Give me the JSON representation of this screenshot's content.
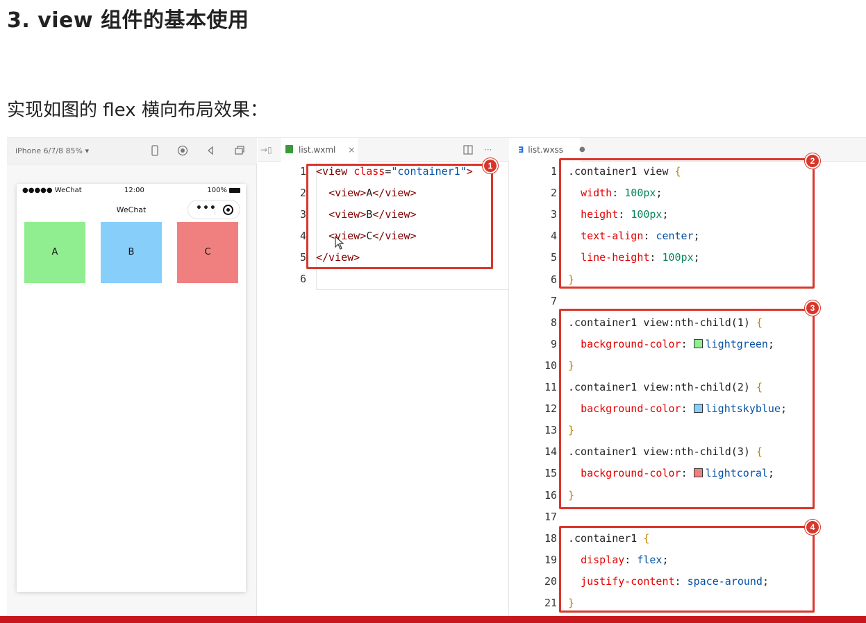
{
  "page": {
    "heading": "3. view 组件的基本使用",
    "subheading": "实现如图的 flex 横向布局效果："
  },
  "simulator": {
    "device_label": "iPhone 6/7/8 85% ▾",
    "toolbar_icons": [
      "phone-icon",
      "record-icon",
      "speaker-icon",
      "window-icon"
    ],
    "status_left": "●●●●● WeChat",
    "status_time": "12:00",
    "status_battery": "100%",
    "nav_title": "WeChat",
    "capsule_dots": "•••",
    "boxes": [
      {
        "label": "A",
        "color": "#90ee90"
      },
      {
        "label": "B",
        "color": "#87cefa"
      },
      {
        "label": "C",
        "color": "#f08080"
      }
    ]
  },
  "wxml_pane": {
    "tab_label": "list.wxml",
    "close_glyph": "×",
    "more_glyph": "···",
    "lines": [
      {
        "n": "1",
        "parts": [
          [
            "c-tag",
            "<view "
          ],
          [
            "c-attr",
            "class"
          ],
          [
            "c-plain",
            "="
          ],
          [
            "c-str",
            "\"container1\""
          ],
          [
            "c-tag",
            ">"
          ]
        ]
      },
      {
        "n": "2",
        "parts": [
          [
            "c-plain",
            "  "
          ],
          [
            "c-tag",
            "<view>"
          ],
          [
            "c-plain",
            "A"
          ],
          [
            "c-tag",
            "</view>"
          ]
        ]
      },
      {
        "n": "3",
        "parts": [
          [
            "c-plain",
            "  "
          ],
          [
            "c-tag",
            "<view>"
          ],
          [
            "c-plain",
            "B"
          ],
          [
            "c-tag",
            "</view>"
          ]
        ]
      },
      {
        "n": "4",
        "parts": [
          [
            "c-plain",
            "  "
          ],
          [
            "c-tag",
            "<view>"
          ],
          [
            "c-plain",
            "C"
          ],
          [
            "c-tag",
            "</view>"
          ]
        ]
      },
      {
        "n": "5",
        "parts": [
          [
            "c-tag",
            "</view>"
          ]
        ]
      },
      {
        "n": "6",
        "parts": []
      }
    ]
  },
  "wxss_pane": {
    "tab_label": "list.wxss",
    "modified_glyph": "●",
    "lines": [
      {
        "n": "1",
        "parts": [
          [
            "c-plain",
            ".container1 view "
          ],
          [
            "c-brace",
            "{"
          ]
        ]
      },
      {
        "n": "2",
        "parts": [
          [
            "c-plain",
            "  "
          ],
          [
            "c-prop",
            "width"
          ],
          [
            "c-plain",
            ": "
          ],
          [
            "c-val",
            "100px"
          ],
          [
            "c-plain",
            ";"
          ]
        ]
      },
      {
        "n": "3",
        "parts": [
          [
            "c-plain",
            "  "
          ],
          [
            "c-prop",
            "height"
          ],
          [
            "c-plain",
            ": "
          ],
          [
            "c-val",
            "100px"
          ],
          [
            "c-plain",
            ";"
          ]
        ]
      },
      {
        "n": "4",
        "parts": [
          [
            "c-plain",
            "  "
          ],
          [
            "c-prop",
            "text-align"
          ],
          [
            "c-plain",
            ": "
          ],
          [
            "c-kw",
            "center"
          ],
          [
            "c-plain",
            ";"
          ]
        ]
      },
      {
        "n": "5",
        "parts": [
          [
            "c-plain",
            "  "
          ],
          [
            "c-prop",
            "line-height"
          ],
          [
            "c-plain",
            ": "
          ],
          [
            "c-val",
            "100px"
          ],
          [
            "c-plain",
            ";"
          ]
        ]
      },
      {
        "n": "6",
        "parts": [
          [
            "c-brace",
            "}"
          ]
        ]
      },
      {
        "n": "7",
        "parts": []
      },
      {
        "n": "8",
        "parts": [
          [
            "c-plain",
            ".container1 view:nth-child(1) "
          ],
          [
            "c-brace",
            "{"
          ]
        ]
      },
      {
        "n": "9",
        "parts": [
          [
            "c-plain",
            "  "
          ],
          [
            "c-prop",
            "background-color"
          ],
          [
            "c-plain",
            ": "
          ],
          [
            "swatch",
            "#90ee90"
          ],
          [
            "c-kw",
            "lightgreen"
          ],
          [
            "c-plain",
            ";"
          ]
        ]
      },
      {
        "n": "10",
        "parts": [
          [
            "c-brace",
            "}"
          ]
        ]
      },
      {
        "n": "11",
        "parts": [
          [
            "c-plain",
            ".container1 view:nth-child(2) "
          ],
          [
            "c-brace",
            "{"
          ]
        ]
      },
      {
        "n": "12",
        "parts": [
          [
            "c-plain",
            "  "
          ],
          [
            "c-prop",
            "background-color"
          ],
          [
            "c-plain",
            ": "
          ],
          [
            "swatch",
            "#87cefa"
          ],
          [
            "c-kw",
            "lightskyblue"
          ],
          [
            "c-plain",
            ";"
          ]
        ]
      },
      {
        "n": "13",
        "parts": [
          [
            "c-brace",
            "}"
          ]
        ]
      },
      {
        "n": "14",
        "parts": [
          [
            "c-plain",
            ".container1 view:nth-child(3) "
          ],
          [
            "c-brace",
            "{"
          ]
        ]
      },
      {
        "n": "15",
        "parts": [
          [
            "c-plain",
            "  "
          ],
          [
            "c-prop",
            "background-color"
          ],
          [
            "c-plain",
            ": "
          ],
          [
            "swatch",
            "#f08080"
          ],
          [
            "c-kw",
            "lightcoral"
          ],
          [
            "c-plain",
            ";"
          ]
        ]
      },
      {
        "n": "16",
        "parts": [
          [
            "c-brace",
            "}"
          ]
        ]
      },
      {
        "n": "17",
        "parts": []
      },
      {
        "n": "18",
        "parts": [
          [
            "c-plain",
            ".container1 "
          ],
          [
            "c-brace",
            "{"
          ]
        ]
      },
      {
        "n": "19",
        "parts": [
          [
            "c-plain",
            "  "
          ],
          [
            "c-prop",
            "display"
          ],
          [
            "c-plain",
            ": "
          ],
          [
            "c-kw",
            "flex"
          ],
          [
            "c-plain",
            ";"
          ]
        ]
      },
      {
        "n": "20",
        "parts": [
          [
            "c-plain",
            "  "
          ],
          [
            "c-prop",
            "justify-content"
          ],
          [
            "c-plain",
            ": "
          ],
          [
            "c-kw",
            "space-around"
          ],
          [
            "c-plain",
            ";"
          ]
        ]
      },
      {
        "n": "21",
        "parts": [
          [
            "c-brace",
            "}"
          ]
        ]
      }
    ]
  },
  "badges": [
    "1",
    "2",
    "3",
    "4"
  ],
  "colors": {
    "highlight": "#d9362b",
    "bottom_bar": "#c8171d"
  }
}
